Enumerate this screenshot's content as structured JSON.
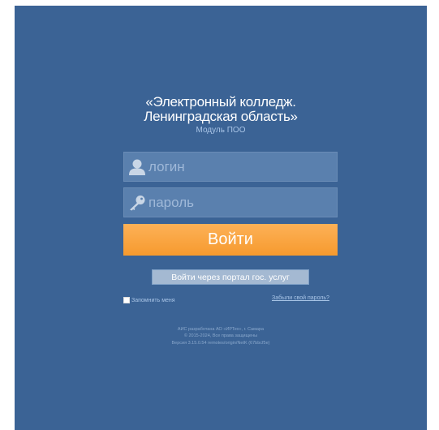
{
  "header": {
    "title_line1": "«Электронный колледж.",
    "title_line2": "Ленинградская область»",
    "subtitle": "Модуль ПОО"
  },
  "form": {
    "login_placeholder": "логин",
    "login_value": "",
    "password_placeholder": "пароль",
    "password_value": "",
    "login_button": "Войти",
    "gosuslugi_button": "Войти через портал гос. услуг",
    "remember_label": "Запомнить меня",
    "remember_checked": false,
    "forgot_link": "Забыли свой пароль?"
  },
  "footer": {
    "line1": "АИС разработана АО «ИРТех», г. Самара",
    "line2": "© 2015-2024, Все права защищены",
    "line3": "Версия 3.15.0.54 remotes/origin/NetK (67bbcf5e)"
  },
  "icons": {
    "login": "user-icon",
    "password": "key-icon"
  },
  "colors": {
    "background": "#3b6395",
    "accent": "#f69a2e",
    "field_bg": "#5a80ae"
  }
}
